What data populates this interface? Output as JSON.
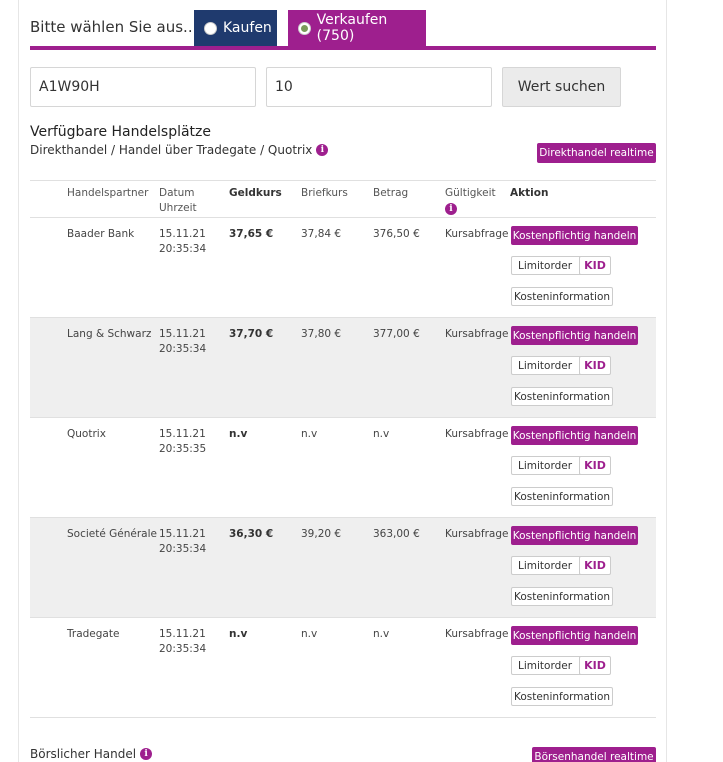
{
  "order": {
    "mode_label": "Bitte wählen Sie aus...",
    "buy_label": "Kaufen",
    "sell_label": "Verkaufen (750)",
    "selected": "sell"
  },
  "search": {
    "isin_value": "A1W90H",
    "quantity_value": "10",
    "button_label": "Wert suchen"
  },
  "venues": {
    "title": "Verfügbare Handelsplätze",
    "subtitle": "Direkthandel / Handel über Tradegate / Quotrix",
    "realtime_button": "Direkthandel realtime"
  },
  "table": {
    "headers": {
      "partner": "Handelspartner",
      "date": "Datum",
      "time": "Uhrzeit",
      "bid": "Geldkurs",
      "ask": "Briefkurs",
      "amount": "Betrag",
      "validity": "Gültigkeit",
      "action": "Aktion"
    },
    "rows": [
      {
        "partner": "Baader Bank",
        "date": "15.11.21",
        "time": "20:35:34",
        "bid": "37,65 €",
        "ask": "37,84 €",
        "amount": "376,50 €",
        "validity": "Kursabfrage"
      },
      {
        "partner": "Lang & Schwarz",
        "date": "15.11.21",
        "time": "20:35:34",
        "bid": "37,70 €",
        "ask": "37,80 €",
        "amount": "377,00 €",
        "validity": "Kursabfrage"
      },
      {
        "partner": "Quotrix",
        "date": "15.11.21",
        "time": "20:35:35",
        "bid": "n.v",
        "ask": "n.v",
        "amount": "n.v",
        "validity": "Kursabfrage"
      },
      {
        "partner": "Societé Générale",
        "date": "15.11.21",
        "time": "20:35:34",
        "bid": "36,30 €",
        "ask": "39,20 €",
        "amount": "363,00 €",
        "validity": "Kursabfrage"
      },
      {
        "partner": "Tradegate",
        "date": "15.11.21",
        "time": "20:35:34",
        "bid": "n.v",
        "ask": "n.v",
        "amount": "n.v",
        "validity": "Kursabfrage"
      }
    ],
    "actions": {
      "trade": "Kostenpflichtig handeln",
      "limit": "Limitorder",
      "kid": "KID",
      "cost": "Kosteninformation"
    }
  },
  "exchange": {
    "title": "Börslicher Handel",
    "realtime_button": "Börsenhandel realtime"
  },
  "icons": {
    "info": "info-icon",
    "radio": "radio-icon"
  },
  "colors": {
    "brand": "#9e1f8e",
    "navy": "#1f3a6e",
    "row_alt": "#efefef"
  }
}
